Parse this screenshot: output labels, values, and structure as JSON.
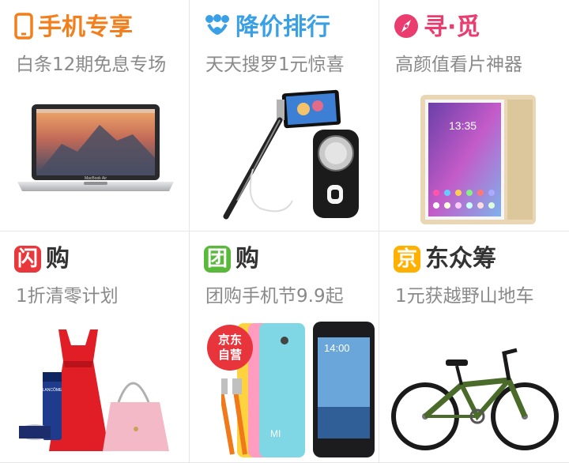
{
  "colors": {
    "phone_orange": "#f27f1b",
    "discount_blue": "#3aa0e6",
    "seek_pink": "#ea3c6f",
    "flash_red": "#e8383c",
    "group_green": "#58b93a",
    "crowd_yellow": "#ffb000"
  },
  "tiles": [
    {
      "title": "手机专享",
      "subtitle": "白条12期免息专场",
      "icon": "phone-icon"
    },
    {
      "title": "降价排行",
      "subtitle": "天天搜罗1元惊喜",
      "icon": "trophy-icon"
    },
    {
      "title": "寻·觅",
      "subtitle": "高颜值看片神器",
      "icon": "compass-icon"
    },
    {
      "badge": "闪",
      "title": "购",
      "subtitle": "1折清零计划"
    },
    {
      "badge": "团",
      "title": "购",
      "subtitle": "团购手机节9.9起"
    },
    {
      "badge": "京",
      "title": "东众筹",
      "subtitle": "1元获越野山地车"
    }
  ],
  "sticker": {
    "line1": "京东",
    "line2": "自营"
  },
  "products": {
    "laptop_brand": "MacBook Air",
    "tablet_time": "13:35",
    "cosmetic_brand": "LANCÔME",
    "phone_time": "14:00",
    "phone_brand": "MI"
  }
}
